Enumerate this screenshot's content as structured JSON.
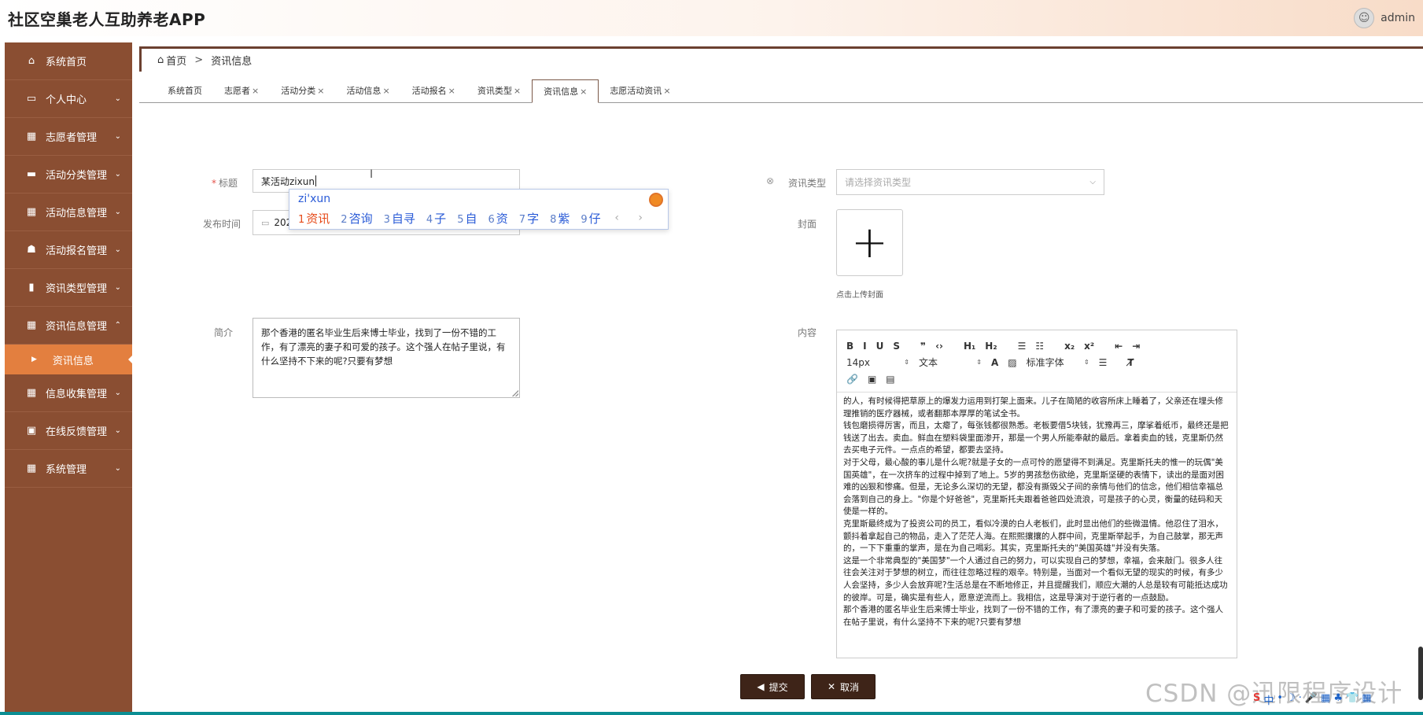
{
  "header": {
    "title": "社区空巢老人互助养老APP",
    "username": "admin"
  },
  "sidebar": {
    "items": [
      {
        "label": "系统首页",
        "icon": "home-icon",
        "glyph": "⌂"
      },
      {
        "label": "个人中心",
        "icon": "calendar-icon",
        "glyph": "▭"
      },
      {
        "label": "志愿者管理",
        "icon": "grid-icon",
        "glyph": "▦"
      },
      {
        "label": "活动分类管理",
        "icon": "monitor-icon",
        "glyph": "▬"
      },
      {
        "label": "活动信息管理",
        "icon": "grid-icon",
        "glyph": "▦"
      },
      {
        "label": "活动报名管理",
        "icon": "thumb-icon",
        "glyph": "☗"
      },
      {
        "label": "资讯类型管理",
        "icon": "bar-chart-icon",
        "glyph": "▮"
      },
      {
        "label": "资讯信息管理",
        "icon": "grid-icon",
        "glyph": "▦"
      },
      {
        "label": "资讯信息",
        "sub": true
      },
      {
        "label": "信息收集管理",
        "icon": "grid-icon",
        "glyph": "▦"
      },
      {
        "label": "在线反馈管理",
        "icon": "clipboard-icon",
        "glyph": "▣"
      },
      {
        "label": "系统管理",
        "icon": "grid-icon",
        "glyph": "▦"
      }
    ]
  },
  "breadcrumb": {
    "home": "首页",
    "current": "资讯信息"
  },
  "tabs": [
    {
      "label": "系统首页",
      "closable": false
    },
    {
      "label": "志愿者",
      "closable": true
    },
    {
      "label": "活动分类",
      "closable": true
    },
    {
      "label": "活动信息",
      "closable": true
    },
    {
      "label": "活动报名",
      "closable": true
    },
    {
      "label": "资讯类型",
      "closable": true
    },
    {
      "label": "资讯信息",
      "closable": true,
      "active": true
    },
    {
      "label": "志愿活动资讯",
      "closable": true
    }
  ],
  "form": {
    "title_label": "标题",
    "title_value": "某活动zixun",
    "type_label": "资讯类型",
    "type_placeholder": "请选择资讯类型",
    "date_label": "发布时间",
    "date_value": "202",
    "cover_label": "封面",
    "cover_hint": "点击上传封面",
    "intro_label": "简介",
    "intro_value": "那个香港的匿名毕业生后来博士毕业，找到了一份不错的工作，有了漂亮的妻子和可爱的孩子。这个强人在帖子里说，有什么坚持不下来的呢?只要有梦想",
    "content_label": "内容"
  },
  "ime": {
    "pinyin": "zi'xun",
    "candidates": [
      {
        "n": "1",
        "text": "资讯"
      },
      {
        "n": "2",
        "text": "咨询"
      },
      {
        "n": "3",
        "text": "自寻"
      },
      {
        "n": "4",
        "text": "子"
      },
      {
        "n": "5",
        "text": "自"
      },
      {
        "n": "6",
        "text": "资"
      },
      {
        "n": "7",
        "text": "字"
      },
      {
        "n": "8",
        "text": "紫"
      },
      {
        "n": "9",
        "text": "仔"
      }
    ],
    "nav": "‹ ›"
  },
  "editor": {
    "row1": [
      "B",
      "I",
      "U",
      "S",
      "❞",
      "‹›",
      "H₁",
      "H₂",
      "☰",
      "☷",
      "x₂",
      "x²",
      "⇤",
      "⇥"
    ],
    "size": "14px",
    "block": "文本",
    "font": "标准字体",
    "paragraphs": [
      "的人，有时候得把草原上的爆发力运用到打架上面来。儿子在简陋的收容所床上睡着了，父亲还在埋头修理推销的医疗器械，或者翻那本厚厚的笔试全书。",
      "钱包磨损得厉害，而且，太瘪了，每张钱都很熟悉。老板要借5块钱，犹豫再三，摩挲着纸币，最终还是把钱送了出去。卖血。鲜血在塑料袋里面渗开，那是一个男人所能奉献的最后。拿着卖血的钱，克里斯仍然去买电子元件。一点点的希望，都要去坚持。",
      "对于父母，最心酸的事儿是什么呢?就是子女的一点可怜的愿望得不到满足。克里斯托夫的惟一的玩偶\"美国英雄\"，在一次挤车的过程中掉到了地上。5岁的男孩愁伤欲绝，克里斯坚硬的表情下，读出的是面对困难的凶狠和惨痛。但是，无论多么深切的无望，都没有撕毁父子间的亲情与他们的信念，他们相信幸福总会落到自己的身上。\"你是个好爸爸\"，克里斯托夫跟着爸爸四处流浪，可是孩子的心灵，衡量的砝码和天使是一样的。",
      "克里斯最终成为了投资公司的员工，看似冷漠的白人老板们，此时显出他们的些微温情。他忍住了泪水，颤抖着拿起自己的物品，走入了茫茫人海。在熙熙攘攘的人群中间，克里斯举起手，为自己鼓掌，那无声的，一下下重重的掌声，是在为自己喝彩。其实，克里斯托夫的\"美国英雄\"并没有失落。",
      "这是一个非常典型的\"美国梦\"一个人通过自己的努力，可以实现自己的梦想，幸福，会来敲门。很多人往往会关注对于梦想的树立，而往往忽略过程的艰辛。特别是，当面对一个看似无望的现实的时候，有多少人会坚持，多少人会放弃呢?生活总是在不断地修正，并且提醒我们，顺应大潮的人总是较有可能抵达成功的彼岸。可是，确实是有些人，愿意逆流而上。我相信，这是导演对于逆行者的一点鼓励。",
      "那个香港的匿名毕业生后来博士毕业，找到了一份不错的工作，有了漂亮的妻子和可爱的孩子。这个强人在帖子里说，有什么坚持不下来的呢?只要有梦想"
    ]
  },
  "buttons": {
    "submit": "提交",
    "cancel": "取消"
  },
  "watermark": "CSDN @迅限程序设计",
  "tray": [
    "S",
    "中",
    "•",
    "☽",
    "·",
    "🎤",
    "▦",
    "♣",
    "👕",
    "▦"
  ]
}
